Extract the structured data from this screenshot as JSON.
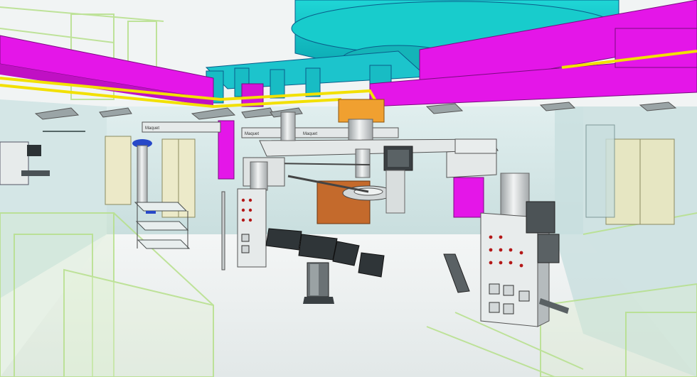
{
  "scene": {
    "labels": {
      "left_boom": "Maquet",
      "top_boom_left": "Maquet",
      "top_boom_right": "Maquet"
    }
  },
  "colors": {
    "duct_cyan": "#14c8c8",
    "duct_magenta": "#e416e8",
    "pipe_yellow": "#f2e000",
    "orange_box": "#f0a030",
    "wall_glass": "#cfe6e6",
    "frame_green": "#b6e08a",
    "table_dark": "#2f3538",
    "copper_panel": "#c46a2c"
  }
}
